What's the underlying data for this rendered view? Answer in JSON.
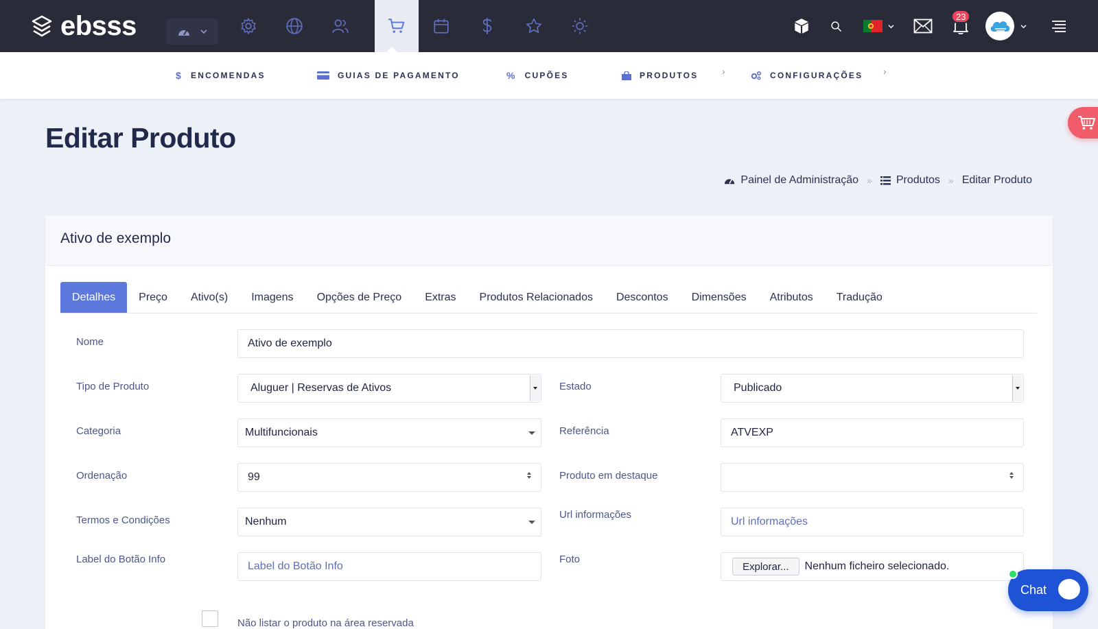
{
  "brand": {
    "name": "ebsss"
  },
  "topnav": {
    "icons": [
      "gear-icon",
      "globe-icon",
      "users-icon",
      "cart-icon",
      "calendar-icon",
      "dollar-icon",
      "star-icon",
      "sun-icon"
    ],
    "active": "cart-icon",
    "notifications_count": "23"
  },
  "subnav": {
    "items": [
      {
        "label": "ENCOMENDAS",
        "icon": "dollar-icon"
      },
      {
        "label": "GUIAS DE PAGAMENTO",
        "icon": "card-icon"
      },
      {
        "label": "CUPÕES",
        "icon": "percent-icon"
      },
      {
        "label": "PRODUTOS",
        "icon": "bag-icon"
      },
      {
        "label": "CONFIGURAÇÕES",
        "icon": "cogs-icon"
      }
    ]
  },
  "page": {
    "title": "Editar Produto",
    "breadcrumb": [
      "Painel de Administração",
      "Produtos",
      "Editar Produto"
    ]
  },
  "card": {
    "title": "Ativo de exemplo",
    "tabs": [
      "Detalhes",
      "Preço",
      "Ativo(s)",
      "Imagens",
      "Opções de Preço",
      "Extras",
      "Produtos Relacionados",
      "Descontos",
      "Dimensões",
      "Atributos",
      "Tradução"
    ],
    "active_tab": "Detalhes"
  },
  "form": {
    "nome": {
      "label": "Nome",
      "value": "Ativo de exemplo"
    },
    "tipo": {
      "label": "Tipo de Produto",
      "value": "Aluguer | Reservas de Ativos"
    },
    "estado": {
      "label": "Estado",
      "value": "Publicado"
    },
    "categoria": {
      "label": "Categoria",
      "value": "Multifuncionais"
    },
    "referencia": {
      "label": "Referência",
      "value": "ATVEXP"
    },
    "ordenacao": {
      "label": "Ordenação",
      "value": "99"
    },
    "destaque": {
      "label": "Produto em destaque",
      "value": ""
    },
    "termos": {
      "label": "Termos e Condições",
      "value": "Nenhum"
    },
    "url": {
      "label": "Url informações",
      "placeholder": "Url informações"
    },
    "label_info": {
      "label": "Label do Botão Info",
      "placeholder": "Label do Botão Info"
    },
    "foto": {
      "label": "Foto",
      "button": "Explorar...",
      "status": "Nenhum ficheiro selecionado."
    },
    "nao_listar": {
      "label": "Não listar o produto na área reservada"
    }
  },
  "chat": {
    "label": "Chat"
  },
  "colors": {
    "topbar": "#292b39",
    "accent": "#5d78dc",
    "badge": "#f0435d",
    "chat": "#1e53d6"
  }
}
